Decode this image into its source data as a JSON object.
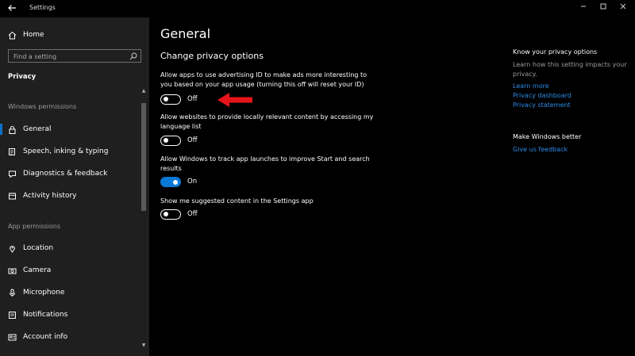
{
  "window": {
    "title": "Settings"
  },
  "sidebar": {
    "home_label": "Home",
    "search_placeholder": "Find a setting",
    "category": "Privacy",
    "windows_permissions_header": "Windows permissions",
    "windows_items": [
      {
        "label": "General",
        "icon": "lock-icon",
        "selected": true
      },
      {
        "label": "Speech, inking & typing",
        "icon": "speech-icon"
      },
      {
        "label": "Diagnostics & feedback",
        "icon": "feedback-icon"
      },
      {
        "label": "Activity history",
        "icon": "history-icon"
      }
    ],
    "app_permissions_header": "App permissions",
    "app_items": [
      {
        "label": "Location",
        "icon": "location-icon"
      },
      {
        "label": "Camera",
        "icon": "camera-icon"
      },
      {
        "label": "Microphone",
        "icon": "microphone-icon"
      },
      {
        "label": "Notifications",
        "icon": "notifications-icon"
      },
      {
        "label": "Account info",
        "icon": "account-info-icon"
      }
    ]
  },
  "main": {
    "title": "General",
    "subtitle": "Change privacy options",
    "options": [
      {
        "desc": "Allow apps to use advertising ID to make ads more interesting to you based on your app usage (turning this off will reset your ID)",
        "state": "Off",
        "on": false
      },
      {
        "desc": "Allow websites to provide locally relevant content by accessing my language list",
        "state": "Off",
        "on": false
      },
      {
        "desc": "Allow Windows to track app launches to improve Start and search results",
        "state": "On",
        "on": true
      },
      {
        "desc": "Show me suggested content in the Settings app",
        "state": "Off",
        "on": false
      }
    ]
  },
  "right_panel": {
    "know_header": "Know your privacy options",
    "know_text": "Learn how this setting impacts your privacy.",
    "links": [
      "Learn more",
      "Privacy dashboard",
      "Privacy statement"
    ],
    "better_header": "Make Windows better",
    "feedback_link": "Give us feedback"
  },
  "colors": {
    "accent": "#0a78d7",
    "link": "#2e8be6",
    "annotation_arrow": "#e8141c"
  }
}
